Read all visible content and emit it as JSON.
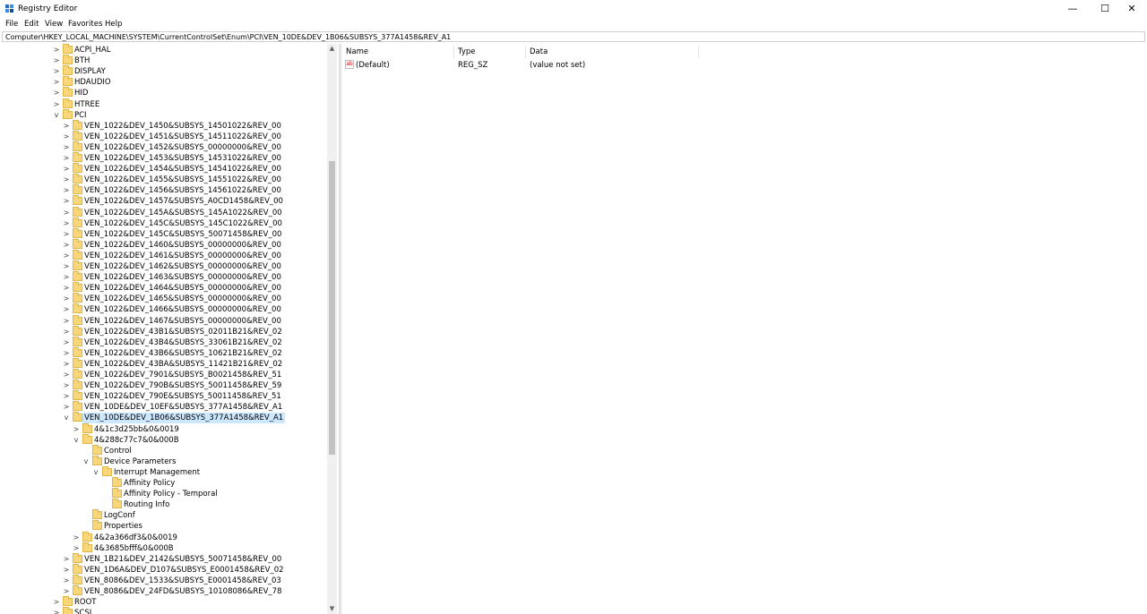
{
  "window": {
    "title": "Registry Editor",
    "minimize_glyph": "—",
    "maximize_glyph": "☐",
    "close_glyph": "✕"
  },
  "menu": [
    "File",
    "Edit",
    "View",
    "Favorites",
    "Help"
  ],
  "address": "Computer\\HKEY_LOCAL_MACHINE\\SYSTEM\\CurrentControlSet\\Enum\\PCI\\VEN_10DE&DEV_1B06&SUBSYS_377A1458&REV_A1",
  "tree": [
    {
      "label": "ACPI_HAL",
      "level": 0,
      "exp": ">"
    },
    {
      "label": "BTH",
      "level": 0,
      "exp": ">"
    },
    {
      "label": "DISPLAY",
      "level": 0,
      "exp": ">"
    },
    {
      "label": "HDAUDIO",
      "level": 0,
      "exp": ">"
    },
    {
      "label": "HID",
      "level": 0,
      "exp": ">"
    },
    {
      "label": "HTREE",
      "level": 0,
      "exp": ">"
    },
    {
      "label": "PCI",
      "level": 0,
      "exp": "v"
    },
    {
      "label": "VEN_1022&DEV_1450&SUBSYS_14501022&REV_00",
      "level": 1,
      "exp": ">"
    },
    {
      "label": "VEN_1022&DEV_1451&SUBSYS_14511022&REV_00",
      "level": 1,
      "exp": ">"
    },
    {
      "label": "VEN_1022&DEV_1452&SUBSYS_00000000&REV_00",
      "level": 1,
      "exp": ">"
    },
    {
      "label": "VEN_1022&DEV_1453&SUBSYS_14531022&REV_00",
      "level": 1,
      "exp": ">"
    },
    {
      "label": "VEN_1022&DEV_1454&SUBSYS_14541022&REV_00",
      "level": 1,
      "exp": ">"
    },
    {
      "label": "VEN_1022&DEV_1455&SUBSYS_14551022&REV_00",
      "level": 1,
      "exp": ">"
    },
    {
      "label": "VEN_1022&DEV_1456&SUBSYS_14561022&REV_00",
      "level": 1,
      "exp": ">"
    },
    {
      "label": "VEN_1022&DEV_1457&SUBSYS_A0CD1458&REV_00",
      "level": 1,
      "exp": ">"
    },
    {
      "label": "VEN_1022&DEV_145A&SUBSYS_145A1022&REV_00",
      "level": 1,
      "exp": ">"
    },
    {
      "label": "VEN_1022&DEV_145C&SUBSYS_145C1022&REV_00",
      "level": 1,
      "exp": ">"
    },
    {
      "label": "VEN_1022&DEV_145C&SUBSYS_50071458&REV_00",
      "level": 1,
      "exp": ">"
    },
    {
      "label": "VEN_1022&DEV_1460&SUBSYS_00000000&REV_00",
      "level": 1,
      "exp": ">"
    },
    {
      "label": "VEN_1022&DEV_1461&SUBSYS_00000000&REV_00",
      "level": 1,
      "exp": ">"
    },
    {
      "label": "VEN_1022&DEV_1462&SUBSYS_00000000&REV_00",
      "level": 1,
      "exp": ">"
    },
    {
      "label": "VEN_1022&DEV_1463&SUBSYS_00000000&REV_00",
      "level": 1,
      "exp": ">"
    },
    {
      "label": "VEN_1022&DEV_1464&SUBSYS_00000000&REV_00",
      "level": 1,
      "exp": ">"
    },
    {
      "label": "VEN_1022&DEV_1465&SUBSYS_00000000&REV_00",
      "level": 1,
      "exp": ">"
    },
    {
      "label": "VEN_1022&DEV_1466&SUBSYS_00000000&REV_00",
      "level": 1,
      "exp": ">"
    },
    {
      "label": "VEN_1022&DEV_1467&SUBSYS_00000000&REV_00",
      "level": 1,
      "exp": ">"
    },
    {
      "label": "VEN_1022&DEV_43B1&SUBSYS_02011B21&REV_02",
      "level": 1,
      "exp": ">"
    },
    {
      "label": "VEN_1022&DEV_43B4&SUBSYS_33061B21&REV_02",
      "level": 1,
      "exp": ">"
    },
    {
      "label": "VEN_1022&DEV_43B6&SUBSYS_10621B21&REV_02",
      "level": 1,
      "exp": ">"
    },
    {
      "label": "VEN_1022&DEV_43BA&SUBSYS_11421B21&REV_02",
      "level": 1,
      "exp": ">"
    },
    {
      "label": "VEN_1022&DEV_7901&SUBSYS_B0021458&REV_51",
      "level": 1,
      "exp": ">"
    },
    {
      "label": "VEN_1022&DEV_790B&SUBSYS_50011458&REV_59",
      "level": 1,
      "exp": ">"
    },
    {
      "label": "VEN_1022&DEV_790E&SUBSYS_50011458&REV_51",
      "level": 1,
      "exp": ">"
    },
    {
      "label": "VEN_10DE&DEV_10EF&SUBSYS_377A1458&REV_A1",
      "level": 1,
      "exp": ">"
    },
    {
      "label": "VEN_10DE&DEV_1B06&SUBSYS_377A1458&REV_A1",
      "level": 1,
      "exp": "v",
      "selected": true
    },
    {
      "label": "4&1c3d25bb&0&0019",
      "level": 2,
      "exp": ">"
    },
    {
      "label": "4&288c77c7&0&000B",
      "level": 2,
      "exp": "v"
    },
    {
      "label": "Control",
      "level": 3,
      "exp": ""
    },
    {
      "label": "Device Parameters",
      "level": 3,
      "exp": "v"
    },
    {
      "label": "Interrupt Management",
      "level": 4,
      "exp": "v"
    },
    {
      "label": "Affinity Policy",
      "level": 5,
      "exp": ""
    },
    {
      "label": "Affinity Policy - Temporal",
      "level": 5,
      "exp": ""
    },
    {
      "label": "Routing Info",
      "level": 5,
      "exp": ""
    },
    {
      "label": "LogConf",
      "level": 3,
      "exp": ""
    },
    {
      "label": "Properties",
      "level": 3,
      "exp": ""
    },
    {
      "label": "4&2a366df3&0&0019",
      "level": 2,
      "exp": ">"
    },
    {
      "label": "4&3685bfff&0&000B",
      "level": 2,
      "exp": ">"
    },
    {
      "label": "VEN_1B21&DEV_2142&SUBSYS_50071458&REV_00",
      "level": 1,
      "exp": ">"
    },
    {
      "label": "VEN_1D6A&DEV_D107&SUBSYS_E0001458&REV_02",
      "level": 1,
      "exp": ">"
    },
    {
      "label": "VEN_8086&DEV_1533&SUBSYS_E0001458&REV_03",
      "level": 1,
      "exp": ">"
    },
    {
      "label": "VEN_8086&DEV_24FD&SUBSYS_10108086&REV_78",
      "level": 1,
      "exp": ">"
    },
    {
      "label": "ROOT",
      "level": 0,
      "exp": ">"
    },
    {
      "label": "SCSI",
      "level": 0,
      "exp": ">"
    }
  ],
  "values": {
    "headers": {
      "name": "Name",
      "type": "Type",
      "data": "Data"
    },
    "rows": [
      {
        "name": "(Default)",
        "type": "REG_SZ",
        "data": "(value not set)",
        "icon": "ab-icon"
      }
    ]
  },
  "scrollbar": {
    "up": "▲",
    "down": "▼"
  }
}
